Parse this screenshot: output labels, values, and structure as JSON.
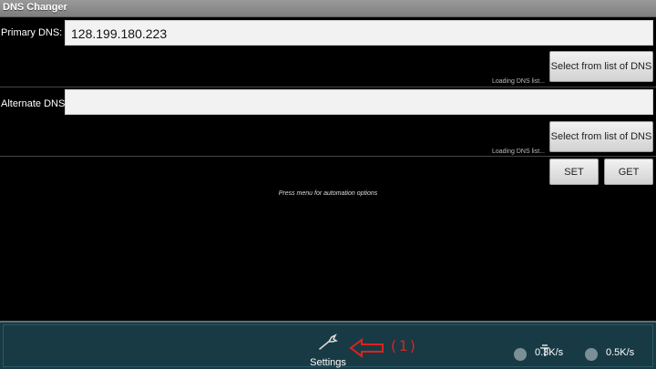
{
  "app": {
    "title": "DNS Changer"
  },
  "primary": {
    "label": "Primary DNS:",
    "value": "128.199.180.223",
    "select_button": "Select from list of DNS",
    "loading": "Loading DNS list..."
  },
  "alternate": {
    "label": "Alternate DNS:",
    "value": "",
    "select_button": "Select from list of DNS",
    "loading": "Loading DNS list..."
  },
  "actions": {
    "set": "SET",
    "get": "GET"
  },
  "hint": "Press menu for automation options",
  "bottom": {
    "settings_label": "Settings",
    "annotation": "(1)",
    "download_speed": "0.3K/s",
    "upload_speed": "0.5K/s"
  },
  "colors": {
    "annotation": "#e02020",
    "bottom_bar": "#183a44"
  },
  "icons": [
    "wrench-icon",
    "arrow-left-icon",
    "download-icon",
    "upload-icon",
    "pin-icon"
  ]
}
